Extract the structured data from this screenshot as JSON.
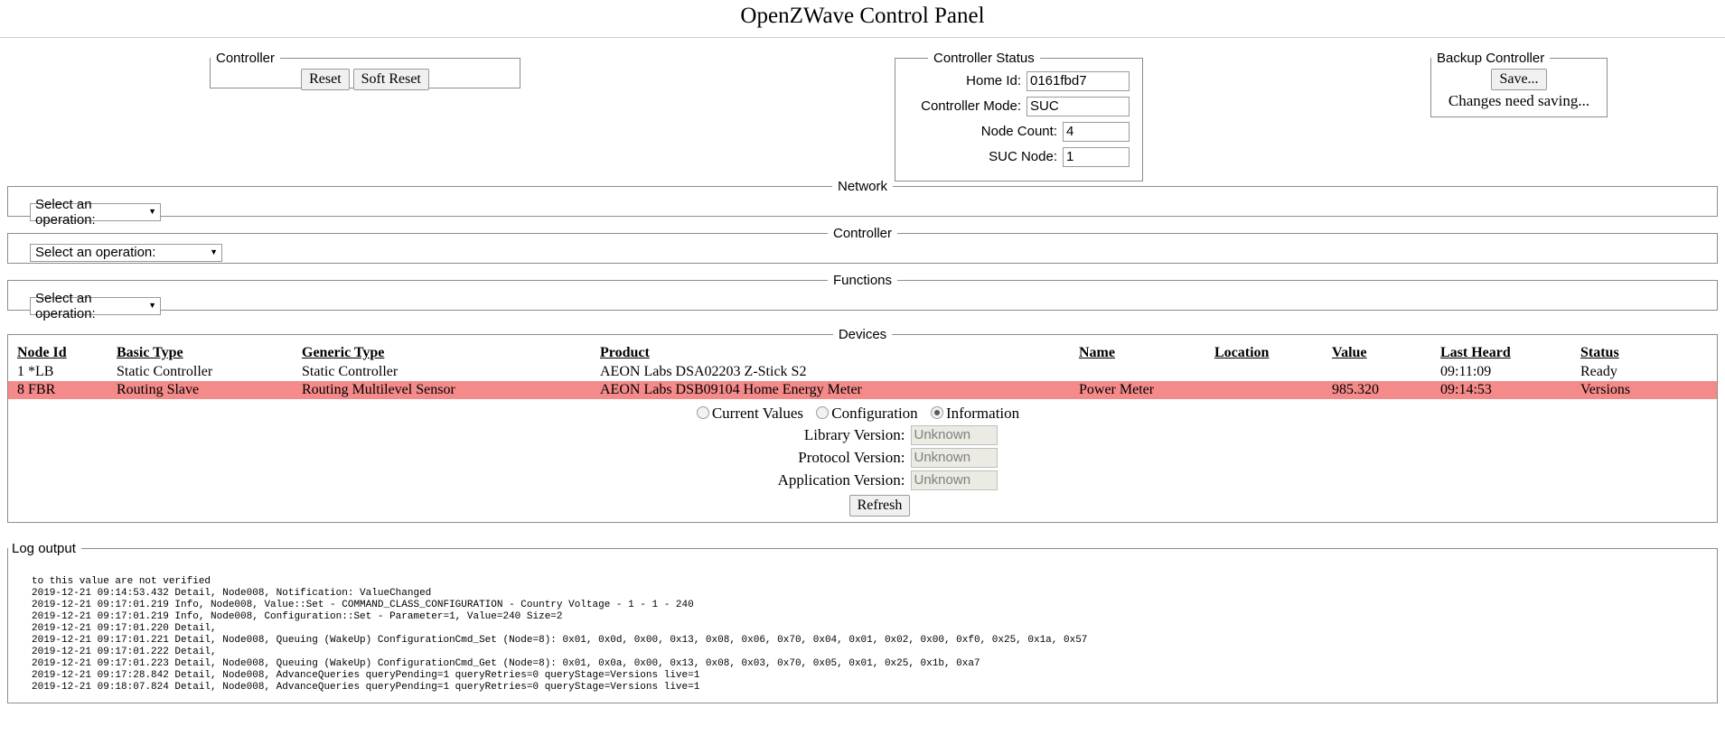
{
  "page": {
    "title": "OpenZWave Control Panel"
  },
  "controller_panel": {
    "legend": "Controller",
    "reset_label": "Reset",
    "soft_reset_label": "Soft Reset"
  },
  "controller_status": {
    "legend": "Controller Status",
    "fields": [
      {
        "label": "Home Id:",
        "value": "0161fbd7"
      },
      {
        "label": "Controller Mode:",
        "value": "SUC"
      },
      {
        "label": "Node Count:",
        "value": "4"
      },
      {
        "label": "SUC Node:",
        "value": "1"
      }
    ]
  },
  "backup_controller": {
    "legend": "Backup Controller",
    "save_label": "Save...",
    "note": "Changes need saving..."
  },
  "operations": {
    "network": {
      "legend": "Network",
      "selected": "Select an operation:"
    },
    "controller": {
      "legend": "Controller",
      "selected": "Select an operation:"
    },
    "functions": {
      "legend": "Functions",
      "selected": "Select an operation:"
    },
    "arrow_glyph": "▼"
  },
  "devices": {
    "legend": "Devices",
    "columns": [
      "Node Id",
      "Basic Type",
      "Generic Type",
      "Product",
      "Name",
      "Location",
      "Value",
      "Last Heard",
      "Status"
    ],
    "rows": [
      {
        "node_id": "1 *LB",
        "basic_type": "Static Controller",
        "generic_type": "Static Controller",
        "product": "AEON Labs DSA02203 Z-Stick S2",
        "name": "",
        "location": "",
        "value": "",
        "last_heard": "09:11:09",
        "status": "Ready",
        "highlighted": false
      },
      {
        "node_id": "8 FBR",
        "basic_type": "Routing Slave",
        "generic_type": "Routing Multilevel Sensor",
        "product": "AEON Labs DSB09104 Home Energy Meter",
        "name": "Power Meter",
        "location": "",
        "value": "985.320",
        "last_heard": "09:14:53",
        "status": "Versions",
        "highlighted": true
      }
    ],
    "highlight_color": "#f58a8a"
  },
  "detail": {
    "radios": [
      {
        "label": "Current Values",
        "checked": false
      },
      {
        "label": "Configuration",
        "checked": false
      },
      {
        "label": "Information",
        "checked": true
      }
    ],
    "versions": [
      {
        "label": "Library Version:",
        "value": "Unknown"
      },
      {
        "label": "Protocol Version:",
        "value": "Unknown"
      },
      {
        "label": "Application Version:",
        "value": "Unknown"
      }
    ],
    "refresh_label": "Refresh"
  },
  "log": {
    "legend": "Log output",
    "lines": [
      "to this value are not verified",
      "2019-12-21 09:14:53.432 Detail, Node008, Notification: ValueChanged",
      "2019-12-21 09:17:01.219 Info, Node008, Value::Set - COMMAND_CLASS_CONFIGURATION - Country Voltage - 1 - 1 - 240",
      "2019-12-21 09:17:01.219 Info, Node008, Configuration::Set - Parameter=1, Value=240 Size=2",
      "2019-12-21 09:17:01.220 Detail,",
      "2019-12-21 09:17:01.221 Detail, Node008, Queuing (WakeUp) ConfigurationCmd_Set (Node=8): 0x01, 0x0d, 0x00, 0x13, 0x08, 0x06, 0x70, 0x04, 0x01, 0x02, 0x00, 0xf0, 0x25, 0x1a, 0x57",
      "2019-12-21 09:17:01.222 Detail,",
      "2019-12-21 09:17:01.223 Detail, Node008, Queuing (WakeUp) ConfigurationCmd_Get (Node=8): 0x01, 0x0a, 0x00, 0x13, 0x08, 0x03, 0x70, 0x05, 0x01, 0x25, 0x1b, 0xa7",
      "2019-12-21 09:17:28.842 Detail, Node008, AdvanceQueries queryPending=1 queryRetries=0 queryStage=Versions live=1",
      "2019-12-21 09:18:07.824 Detail, Node008, AdvanceQueries queryPending=1 queryRetries=0 queryStage=Versions live=1"
    ]
  }
}
